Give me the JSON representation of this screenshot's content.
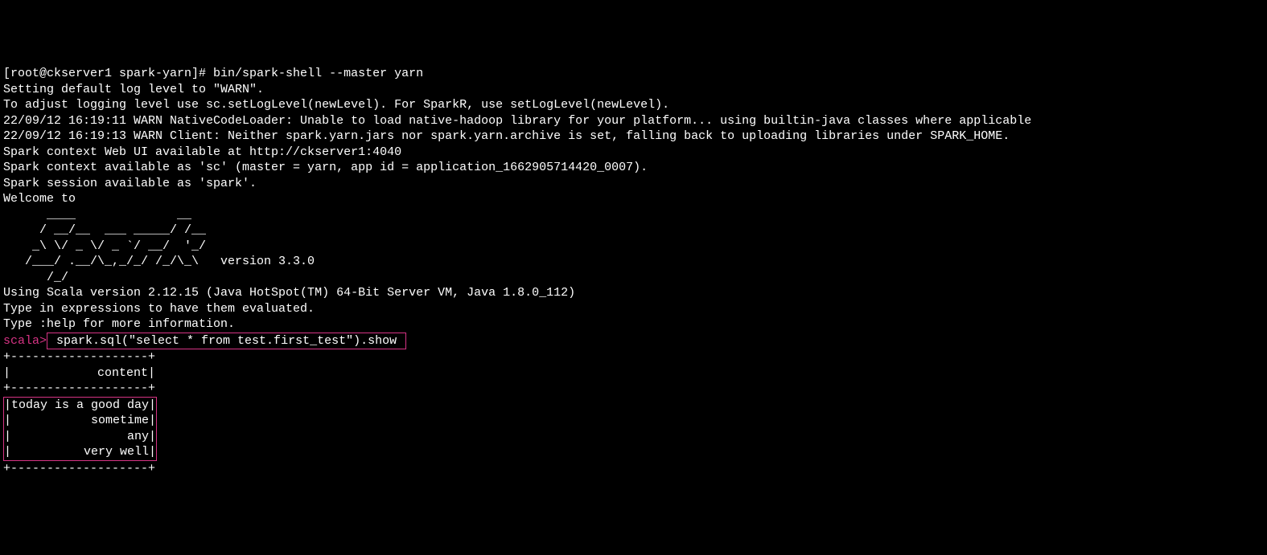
{
  "terminal": {
    "prompt_line": "[root@ckserver1 spark-yarn]# bin/spark-shell --master yarn",
    "log_lines": [
      "Setting default log level to \"WARN\".",
      "To adjust logging level use sc.setLogLevel(newLevel). For SparkR, use setLogLevel(newLevel).",
      "22/09/12 16:19:11 WARN NativeCodeLoader: Unable to load native-hadoop library for your platform... using builtin-java classes where applicable",
      "22/09/12 16:19:13 WARN Client: Neither spark.yarn.jars nor spark.yarn.archive is set, falling back to uploading libraries under SPARK_HOME.",
      "Spark context Web UI available at http://ckserver1:4040",
      "Spark context available as 'sc' (master = yarn, app id = application_1662905714420_0007).",
      "Spark session available as 'spark'.",
      "Welcome to"
    ],
    "spark_logo": [
      "      ____              __",
      "     / __/__  ___ _____/ /__",
      "    _\\ \\/ _ \\/ _ `/ __/  '_/",
      "   /___/ .__/\\_,_/_/ /_/\\_\\   version 3.3.0",
      "      /_/"
    ],
    "info_lines": [
      "",
      "Using Scala version 2.12.15 (Java HotSpot(TM) 64-Bit Server VM, Java 1.8.0_112)",
      "Type in expressions to have them evaluated.",
      "Type :help for more information.",
      ""
    ],
    "scala_prompt": "scala>",
    "scala_command": " spark.sql(\"select * from test.first_test\").show ",
    "table_header_border": "+-------------------+",
    "table_header": "|            content|",
    "table_rows": [
      "|today is a good day|",
      "|           sometime|",
      "|                any|",
      "|          very well|"
    ]
  }
}
